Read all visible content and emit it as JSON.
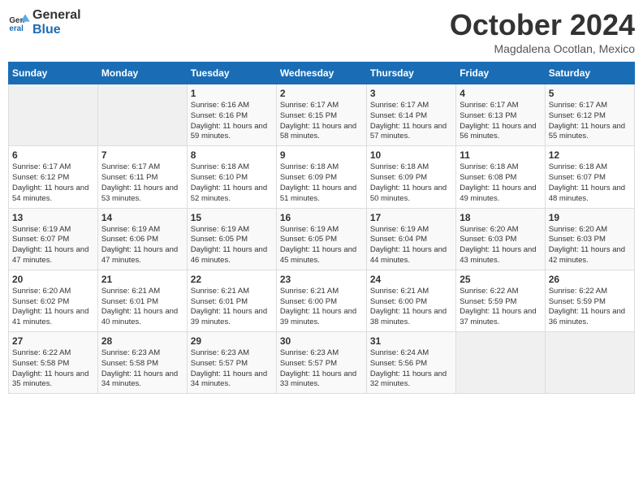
{
  "logo": {
    "line1": "General",
    "line2": "Blue"
  },
  "title": "October 2024",
  "subtitle": "Magdalena Ocotlan, Mexico",
  "days_of_week": [
    "Sunday",
    "Monday",
    "Tuesday",
    "Wednesday",
    "Thursday",
    "Friday",
    "Saturday"
  ],
  "weeks": [
    [
      {
        "num": "",
        "empty": true
      },
      {
        "num": "",
        "empty": true
      },
      {
        "num": "1",
        "sunrise": "6:16 AM",
        "sunset": "6:16 PM",
        "daylight": "11 hours and 59 minutes."
      },
      {
        "num": "2",
        "sunrise": "6:17 AM",
        "sunset": "6:15 PM",
        "daylight": "11 hours and 58 minutes."
      },
      {
        "num": "3",
        "sunrise": "6:17 AM",
        "sunset": "6:14 PM",
        "daylight": "11 hours and 57 minutes."
      },
      {
        "num": "4",
        "sunrise": "6:17 AM",
        "sunset": "6:13 PM",
        "daylight": "11 hours and 56 minutes."
      },
      {
        "num": "5",
        "sunrise": "6:17 AM",
        "sunset": "6:12 PM",
        "daylight": "11 hours and 55 minutes."
      }
    ],
    [
      {
        "num": "6",
        "sunrise": "6:17 AM",
        "sunset": "6:12 PM",
        "daylight": "11 hours and 54 minutes."
      },
      {
        "num": "7",
        "sunrise": "6:17 AM",
        "sunset": "6:11 PM",
        "daylight": "11 hours and 53 minutes."
      },
      {
        "num": "8",
        "sunrise": "6:18 AM",
        "sunset": "6:10 PM",
        "daylight": "11 hours and 52 minutes."
      },
      {
        "num": "9",
        "sunrise": "6:18 AM",
        "sunset": "6:09 PM",
        "daylight": "11 hours and 51 minutes."
      },
      {
        "num": "10",
        "sunrise": "6:18 AM",
        "sunset": "6:09 PM",
        "daylight": "11 hours and 50 minutes."
      },
      {
        "num": "11",
        "sunrise": "6:18 AM",
        "sunset": "6:08 PM",
        "daylight": "11 hours and 49 minutes."
      },
      {
        "num": "12",
        "sunrise": "6:18 AM",
        "sunset": "6:07 PM",
        "daylight": "11 hours and 48 minutes."
      }
    ],
    [
      {
        "num": "13",
        "sunrise": "6:19 AM",
        "sunset": "6:07 PM",
        "daylight": "11 hours and 47 minutes."
      },
      {
        "num": "14",
        "sunrise": "6:19 AM",
        "sunset": "6:06 PM",
        "daylight": "11 hours and 47 minutes."
      },
      {
        "num": "15",
        "sunrise": "6:19 AM",
        "sunset": "6:05 PM",
        "daylight": "11 hours and 46 minutes."
      },
      {
        "num": "16",
        "sunrise": "6:19 AM",
        "sunset": "6:05 PM",
        "daylight": "11 hours and 45 minutes."
      },
      {
        "num": "17",
        "sunrise": "6:19 AM",
        "sunset": "6:04 PM",
        "daylight": "11 hours and 44 minutes."
      },
      {
        "num": "18",
        "sunrise": "6:20 AM",
        "sunset": "6:03 PM",
        "daylight": "11 hours and 43 minutes."
      },
      {
        "num": "19",
        "sunrise": "6:20 AM",
        "sunset": "6:03 PM",
        "daylight": "11 hours and 42 minutes."
      }
    ],
    [
      {
        "num": "20",
        "sunrise": "6:20 AM",
        "sunset": "6:02 PM",
        "daylight": "11 hours and 41 minutes."
      },
      {
        "num": "21",
        "sunrise": "6:21 AM",
        "sunset": "6:01 PM",
        "daylight": "11 hours and 40 minutes."
      },
      {
        "num": "22",
        "sunrise": "6:21 AM",
        "sunset": "6:01 PM",
        "daylight": "11 hours and 39 minutes."
      },
      {
        "num": "23",
        "sunrise": "6:21 AM",
        "sunset": "6:00 PM",
        "daylight": "11 hours and 39 minutes."
      },
      {
        "num": "24",
        "sunrise": "6:21 AM",
        "sunset": "6:00 PM",
        "daylight": "11 hours and 38 minutes."
      },
      {
        "num": "25",
        "sunrise": "6:22 AM",
        "sunset": "5:59 PM",
        "daylight": "11 hours and 37 minutes."
      },
      {
        "num": "26",
        "sunrise": "6:22 AM",
        "sunset": "5:59 PM",
        "daylight": "11 hours and 36 minutes."
      }
    ],
    [
      {
        "num": "27",
        "sunrise": "6:22 AM",
        "sunset": "5:58 PM",
        "daylight": "11 hours and 35 minutes."
      },
      {
        "num": "28",
        "sunrise": "6:23 AM",
        "sunset": "5:58 PM",
        "daylight": "11 hours and 34 minutes."
      },
      {
        "num": "29",
        "sunrise": "6:23 AM",
        "sunset": "5:57 PM",
        "daylight": "11 hours and 34 minutes."
      },
      {
        "num": "30",
        "sunrise": "6:23 AM",
        "sunset": "5:57 PM",
        "daylight": "11 hours and 33 minutes."
      },
      {
        "num": "31",
        "sunrise": "6:24 AM",
        "sunset": "5:56 PM",
        "daylight": "11 hours and 32 minutes."
      },
      {
        "num": "",
        "empty": true
      },
      {
        "num": "",
        "empty": true
      }
    ]
  ],
  "labels": {
    "sunrise": "Sunrise:",
    "sunset": "Sunset:",
    "daylight": "Daylight:"
  }
}
